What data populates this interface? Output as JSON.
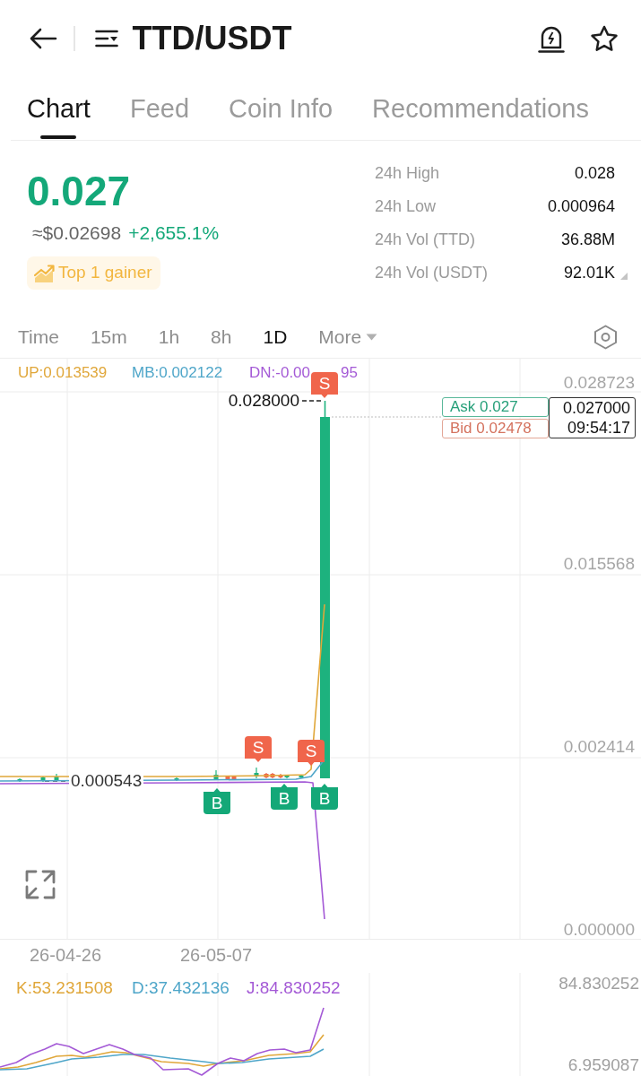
{
  "header": {
    "title": "TTD/USDT"
  },
  "tabs": [
    {
      "label": "Chart",
      "selected": true
    },
    {
      "label": "Feed",
      "selected": false
    },
    {
      "label": "Coin Info",
      "selected": false
    },
    {
      "label": "Recommendations",
      "selected": false
    }
  ],
  "ticker": {
    "last_price": "0.027",
    "fiat_price": "≈$0.02698",
    "change": "+2,655.1%",
    "badge": "Top 1 gainer"
  },
  "stats": [
    {
      "label": "24h High",
      "value": "0.028",
      "has_toggle": false
    },
    {
      "label": "24h Low",
      "value": "0.000964",
      "has_toggle": false
    },
    {
      "label": "24h Vol (TTD)",
      "value": "36.88M",
      "has_toggle": false
    },
    {
      "label": "24h Vol (USDT)",
      "value": "92.01K",
      "has_toggle": true
    }
  ],
  "intervals": [
    {
      "label": "Time",
      "kind": "option",
      "selected": false
    },
    {
      "label": "15m",
      "kind": "option",
      "selected": false
    },
    {
      "label": "1h",
      "kind": "option",
      "selected": false
    },
    {
      "label": "8h",
      "kind": "option",
      "selected": false
    },
    {
      "label": "1D",
      "kind": "option",
      "selected": true
    },
    {
      "label": "More",
      "kind": "dropdown",
      "selected": false
    }
  ],
  "main_chart": {
    "legend": [
      {
        "text": "UP:0.013539",
        "color": "#e0a73a"
      },
      {
        "text": "MB:0.002122",
        "color": "#4fa6c9"
      },
      {
        "text": "DN:-0.00",
        "text_after_marker": "95",
        "color": "#a45ad6"
      }
    ],
    "y_axis_labels": [
      "0.028723",
      "0.015568",
      "0.002414",
      "0.000000"
    ],
    "high_label": "0.028000",
    "low_label": "0.000543",
    "ask": "Ask 0.027",
    "bid": "Bid 0.02478",
    "last_price": "0.027000",
    "countdown": "09:54:17",
    "trade_markers": [
      {
        "kind": "sell",
        "label": "S"
      },
      {
        "kind": "sell",
        "label": "S"
      },
      {
        "kind": "sell",
        "label": "S"
      },
      {
        "kind": "buy",
        "label": "B"
      },
      {
        "kind": "buy",
        "label": "B"
      },
      {
        "kind": "buy",
        "label": "B"
      }
    ]
  },
  "x_axis_labels": [
    "26-04-26",
    "26-05-07"
  ],
  "kdj_chart": {
    "legend": [
      {
        "text": "K:53.231508",
        "color": "#e0a73a"
      },
      {
        "text": "D:37.432136",
        "color": "#4fa6c9"
      },
      {
        "text": "J:84.830252",
        "color": "#a45ad6"
      }
    ],
    "y_axis_labels": [
      "84.830252",
      "6.959087"
    ]
  }
}
